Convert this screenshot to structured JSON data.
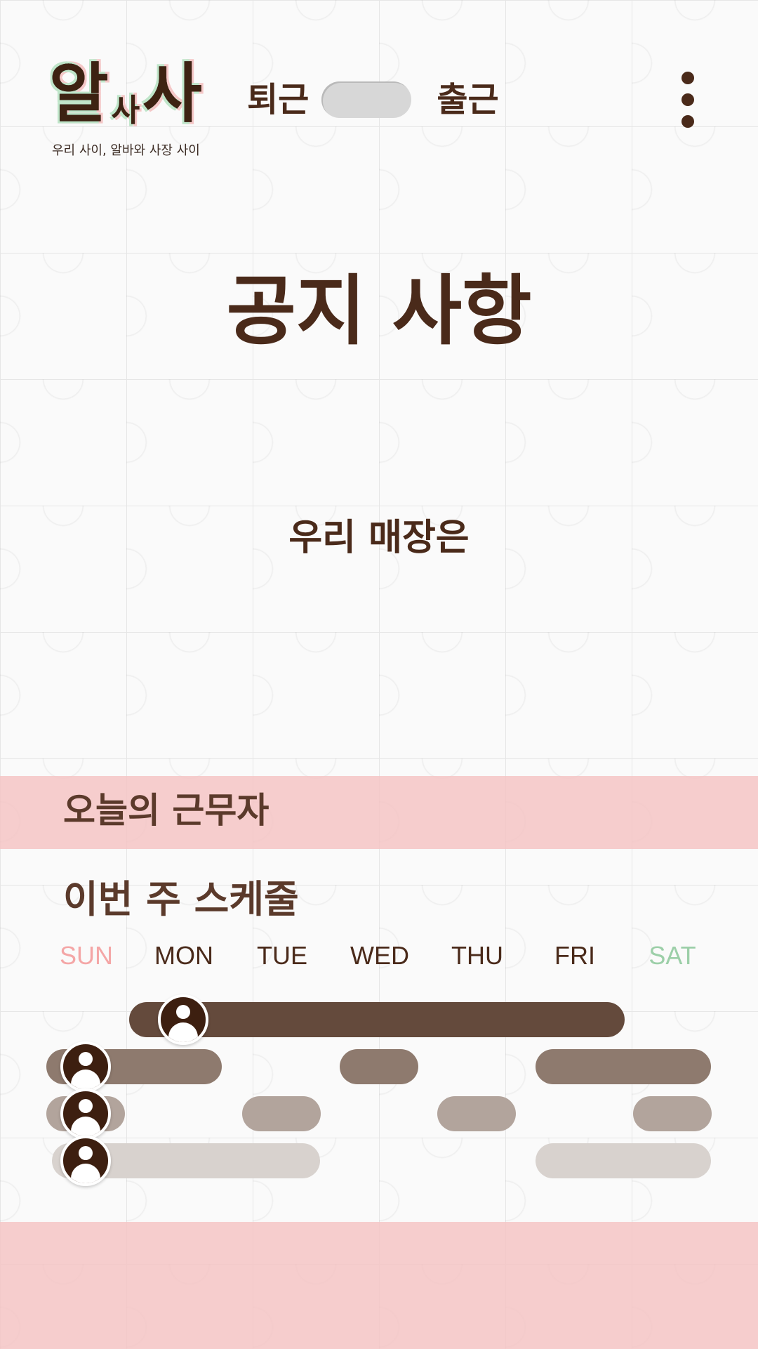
{
  "header": {
    "logo": {
      "big1": "알",
      "small": "사",
      "big2": "사",
      "subtitle": "우리 사이, 알바와 사장 사이"
    },
    "toggle": {
      "left_label": "퇴근",
      "right_label": "출근",
      "state": "off"
    },
    "menu_icon": "more-vertical-icon"
  },
  "notice": {
    "title": "공지 사항",
    "body": "우리 매장은"
  },
  "today": {
    "title": "오늘의 근무자"
  },
  "week": {
    "title": "이번 주 스케줄",
    "days": [
      {
        "label": "SUN",
        "color": "#f4a6a6"
      },
      {
        "label": "MON",
        "color": "#4a2a1a"
      },
      {
        "label": "TUE",
        "color": "#4a2a1a"
      },
      {
        "label": "WED",
        "color": "#4a2a1a"
      },
      {
        "label": "THU",
        "color": "#4a2a1a"
      },
      {
        "label": "FRI",
        "color": "#4a2a1a"
      },
      {
        "label": "SAT",
        "color": "#9ccfa8"
      }
    ]
  },
  "colors": {
    "brand_brown": "#4a2a1a",
    "band_pink": "#f5c4c4",
    "shift_colors": [
      "#644a3c",
      "#8e7a6e",
      "#b2a49c",
      "#d8d2ce"
    ]
  }
}
